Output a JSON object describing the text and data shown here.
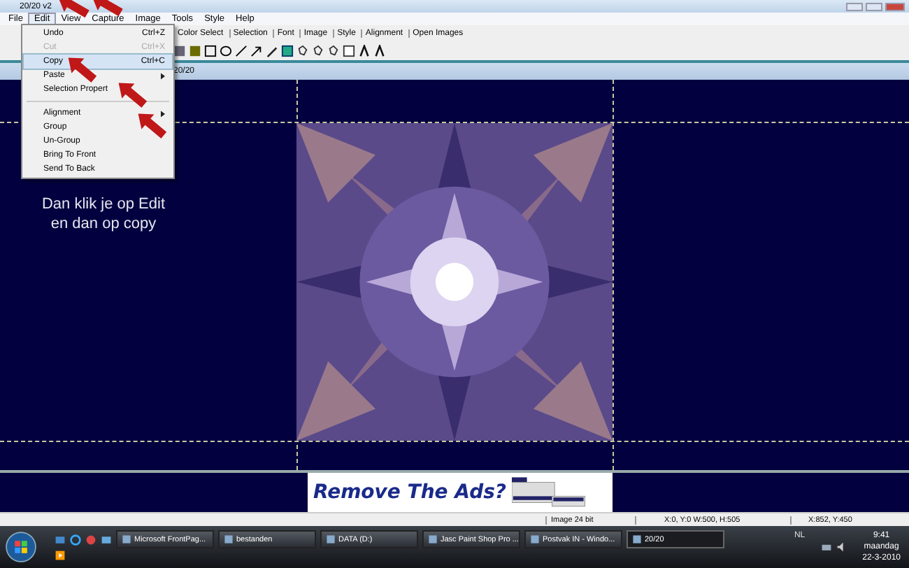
{
  "window": {
    "title": "20/20 v2"
  },
  "menu_bar": [
    {
      "label": "File",
      "selected": false
    },
    {
      "label": "Edit",
      "selected": true
    },
    {
      "label": "View",
      "selected": false
    },
    {
      "label": "Capture",
      "selected": false
    },
    {
      "label": "Image",
      "selected": false
    },
    {
      "label": "Tools",
      "selected": false
    },
    {
      "label": "Style",
      "selected": false
    },
    {
      "label": "Help",
      "selected": false
    }
  ],
  "toolbar_tabs": [
    "Color Select",
    "Selection",
    "Font",
    "Image",
    "Style",
    "Alignment",
    "Open Images"
  ],
  "document": {
    "title": "20/20"
  },
  "canvas_text": [
    "Dan klik je op Edit",
    "en dan op copy"
  ],
  "ad": {
    "text": "Remove The Ads?"
  },
  "edit_menu": [
    {
      "kind": "item",
      "label": "Undo",
      "shortcut": "Ctrl+Z",
      "disabled": false,
      "selected": false
    },
    {
      "kind": "item",
      "label": "Cut",
      "shortcut": "Ctrl+X",
      "disabled": true,
      "selected": false
    },
    {
      "kind": "item",
      "label": "Copy",
      "shortcut": "Ctrl+C",
      "disabled": false,
      "selected": true
    },
    {
      "kind": "submenu",
      "label": "Paste",
      "disabled": false,
      "selected": false
    },
    {
      "kind": "item",
      "label": "Selection Propert",
      "disabled": false,
      "selected": false
    },
    {
      "kind": "separator"
    },
    {
      "kind": "submenu",
      "label": "Alignment",
      "disabled": false,
      "selected": false
    },
    {
      "kind": "item",
      "label": "Group",
      "disabled": false,
      "selected": false
    },
    {
      "kind": "item",
      "label": "Un-Group",
      "disabled": false,
      "selected": false
    },
    {
      "kind": "item",
      "label": "Bring To Front",
      "disabled": false,
      "selected": false
    },
    {
      "kind": "item",
      "label": "Send To Back",
      "disabled": false,
      "selected": false
    }
  ],
  "status_bar": [
    "Image 24 bit",
    "X:0, Y:0 W:500, H:505",
    "X:852, Y:450"
  ],
  "taskbar": {
    "tasks": [
      {
        "label": "Microsoft FrontPag...",
        "selected": false
      },
      {
        "label": "bestanden",
        "selected": false
      },
      {
        "label": "DATA (D:)",
        "selected": false
      },
      {
        "label": "Jasc Paint Shop Pro ...",
        "selected": false
      },
      {
        "label": "Postvak IN - Windo...",
        "selected": false
      },
      {
        "label": "20/20",
        "selected": true
      }
    ],
    "language": "NL",
    "time": "9:41",
    "day": "maandag",
    "date": "22-3-2010"
  }
}
